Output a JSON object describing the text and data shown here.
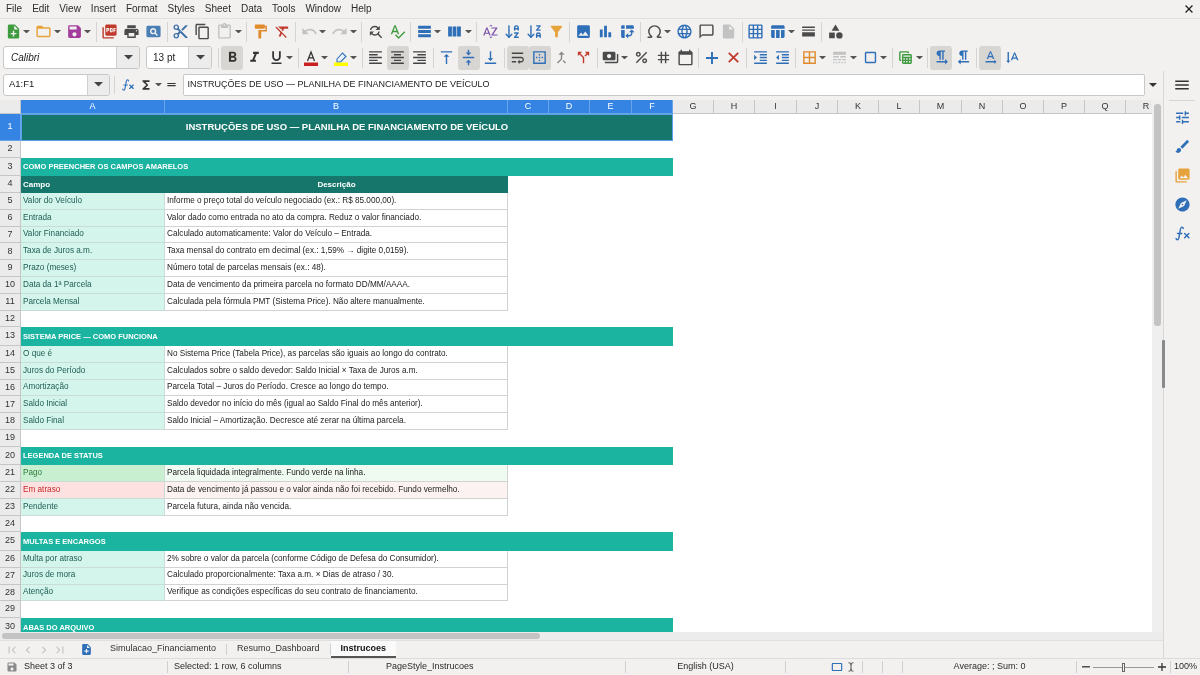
{
  "menu_bar": {
    "items": [
      "File",
      "Edit",
      "View",
      "Insert",
      "Format",
      "Styles",
      "Sheet",
      "Data",
      "Tools",
      "Window",
      "Help"
    ]
  },
  "standard_toolbar": {
    "disabled": {
      "paste": true,
      "undo": true,
      "redo": true,
      "headers_footers": true
    }
  },
  "formatting_toolbar": {
    "font_name": "Calibri",
    "font_size": "13 pt",
    "pressed": {
      "bold": true,
      "italic": false,
      "underline": false,
      "align_left": false,
      "align_center": true,
      "align_right": false,
      "align_top": false,
      "align_middle": true,
      "align_bottom": false,
      "wrap_text": true,
      "merge_center": true,
      "paragraph_ltr": true,
      "paragraph_rtl": false,
      "text_ltr": true,
      "text_ttb": false
    },
    "disabled": {
      "border_style": true
    }
  },
  "formula_bar": {
    "name_box": "A1:F1",
    "content": "INSTRUÇÕES DE USO — PLANILHA DE FINANCIAMENTO DE VEÍCULO"
  },
  "sheet": {
    "columns": [
      {
        "label": "A",
        "selected": true
      },
      {
        "label": "B",
        "selected": true
      },
      {
        "label": "C",
        "selected": true
      },
      {
        "label": "D",
        "selected": true
      },
      {
        "label": "E",
        "selected": true
      },
      {
        "label": "F",
        "selected": true
      },
      {
        "label": "G",
        "selected": false
      },
      {
        "label": "H",
        "selected": false
      },
      {
        "label": "I",
        "selected": false
      },
      {
        "label": "J",
        "selected": false
      },
      {
        "label": "K",
        "selected": false
      },
      {
        "label": "L",
        "selected": false
      },
      {
        "label": "M",
        "selected": false
      },
      {
        "label": "N",
        "selected": false
      },
      {
        "label": "O",
        "selected": false
      },
      {
        "label": "P",
        "selected": false
      },
      {
        "label": "Q",
        "selected": false
      },
      {
        "label": "R",
        "selected": false
      }
    ],
    "rows": [
      {
        "number": "1",
        "selected": true,
        "kind": "title",
        "cells": [
          "INSTRUÇÕES DE USO — PLANILHA DE FINANCIAMENTO DE VEÍCULO"
        ]
      },
      {
        "number": "2",
        "selected": false,
        "kind": "blank"
      },
      {
        "number": "3",
        "selected": false,
        "kind": "section",
        "cells": [
          "COMO PREENCHER OS CAMPOS AMARELOS"
        ]
      },
      {
        "number": "4",
        "selected": false,
        "kind": "header",
        "cells": [
          "Campo",
          "Descrição"
        ]
      },
      {
        "number": "5",
        "selected": false,
        "kind": "entry",
        "cells": [
          "Valor do Veículo",
          "Informe o preço total do veículo negociado (ex.: R$ 85.000,00)."
        ]
      },
      {
        "number": "6",
        "selected": false,
        "kind": "entry",
        "cells": [
          "Entrada",
          "Valor dado como entrada no ato da compra. Reduz o valor financiado."
        ]
      },
      {
        "number": "7",
        "selected": false,
        "kind": "entry",
        "cells": [
          "Valor Financiado",
          "Calculado automaticamente: Valor do Veículo – Entrada."
        ]
      },
      {
        "number": "8",
        "selected": false,
        "kind": "entry",
        "cells": [
          "Taxa de Juros a.m.",
          "Taxa mensal do contrato em decimal (ex.: 1,59% → digite 0,0159)."
        ]
      },
      {
        "number": "9",
        "selected": false,
        "kind": "entry",
        "cells": [
          "Prazo (meses)",
          "Número total de parcelas mensais (ex.: 48)."
        ]
      },
      {
        "number": "10",
        "selected": false,
        "kind": "entry",
        "cells": [
          "Data da 1ª Parcela",
          "Data de vencimento da primeira parcela no formato DD/MM/AAAA."
        ]
      },
      {
        "number": "11",
        "selected": false,
        "kind": "entry",
        "cells": [
          "Parcela Mensal",
          "Calculada pela fórmula PMT (Sistema Price). Não altere manualmente."
        ]
      },
      {
        "number": "12",
        "selected": false,
        "kind": "blank"
      },
      {
        "number": "13",
        "selected": false,
        "kind": "section",
        "cells": [
          "SISTEMA PRICE — COMO FUNCIONA"
        ]
      },
      {
        "number": "14",
        "selected": false,
        "kind": "entry",
        "cells": [
          "O que é",
          "No Sistema Price (Tabela Price), as parcelas são iguais ao longo do contrato."
        ]
      },
      {
        "number": "15",
        "selected": false,
        "kind": "entry",
        "cells": [
          "Juros do Período",
          "Calculados sobre o saldo devedor: Saldo Inicial × Taxa de Juros a.m."
        ]
      },
      {
        "number": "16",
        "selected": false,
        "kind": "entry",
        "cells": [
          "Amortização",
          "Parcela Total – Juros do Período. Cresce ao longo do tempo."
        ]
      },
      {
        "number": "17",
        "selected": false,
        "kind": "entry",
        "cells": [
          "Saldo Inicial",
          "Saldo devedor no início do mês (igual ao Saldo Final do mês anterior)."
        ]
      },
      {
        "number": "18",
        "selected": false,
        "kind": "entry",
        "cells": [
          "Saldo Final",
          "Saldo Inicial – Amortização. Decresce até zerar na última parcela."
        ]
      },
      {
        "number": "19",
        "selected": false,
        "kind": "blank"
      },
      {
        "number": "20",
        "selected": false,
        "kind": "section",
        "cells": [
          "LEGENDA DE STATUS"
        ]
      },
      {
        "number": "21",
        "selected": false,
        "kind": "paid",
        "cells": [
          "Pago",
          "Parcela liquidada integralmente. Fundo verde na linha."
        ]
      },
      {
        "number": "22",
        "selected": false,
        "kind": "overdue",
        "cells": [
          "Em atraso",
          "Data de vencimento já passou e o valor ainda não foi recebido. Fundo vermelho."
        ]
      },
      {
        "number": "23",
        "selected": false,
        "kind": "entry",
        "cells": [
          "Pendente",
          "Parcela futura, ainda não vencida."
        ]
      },
      {
        "number": "24",
        "selected": false,
        "kind": "blank"
      },
      {
        "number": "25",
        "selected": false,
        "kind": "section",
        "cells": [
          "MULTAS E ENCARGOS"
        ]
      },
      {
        "number": "26",
        "selected": false,
        "kind": "entry",
        "cells": [
          "Multa por atraso",
          "2% sobre o valor da parcela (conforme Código de Defesa do Consumidor)."
        ]
      },
      {
        "number": "27",
        "selected": false,
        "kind": "entry",
        "cells": [
          "Juros de mora",
          "Calculado proporcionalmente: Taxa a.m. × Dias de atraso / 30."
        ]
      },
      {
        "number": "28",
        "selected": false,
        "kind": "entry",
        "cells": [
          "Atenção",
          "Verifique as condições específicas do seu contrato de financiamento."
        ]
      },
      {
        "number": "29",
        "selected": false,
        "kind": "blank"
      },
      {
        "number": "30",
        "selected": false,
        "kind": "section",
        "cells": [
          "ABAS DO ARQUIVO"
        ]
      }
    ]
  },
  "sheet_tabs": {
    "navigation_disabled": true,
    "tabs": [
      {
        "label": "Simulacao_Financiamento",
        "selected": false
      },
      {
        "label": "Resumo_Dashboard",
        "selected": false
      },
      {
        "label": "Instrucoes",
        "selected": true
      }
    ]
  },
  "status_bar": {
    "sheet": "Sheet 3 of 3",
    "selection": "Selected: 1 row, 6 columns",
    "page_style": "PageStyle_Instrucoes",
    "language": "English (USA)",
    "summary": "Average: ; Sum: 0",
    "zoom": {
      "reading": "100%",
      "level": 0.5
    }
  }
}
